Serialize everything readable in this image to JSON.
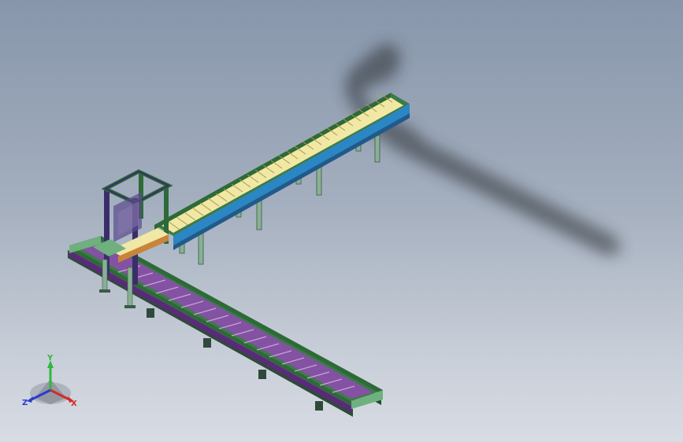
{
  "viewport": {
    "background_top": "#8796ab",
    "background_bottom": "#d8dce3"
  },
  "model": {
    "name": "",
    "parts": [
      "roller-conveyor-upper",
      "roller-conveyor-lower",
      "lift-transfer-frame",
      "support-legs",
      "drop-shadow"
    ],
    "colors": {
      "frame_green": "#2d6a37",
      "side_rail_blue": "#2a86c4",
      "rollers_yellow": "#f0e8a4",
      "rollers_purple": "#7a3c96",
      "legs": "#88b095",
      "lift_frame": "#3a2e6a"
    }
  },
  "triad": {
    "x_label": "X",
    "y_label": "Y",
    "z_label": "Z",
    "x_color": "#d42a2a",
    "y_color": "#2fb83c",
    "z_color": "#2a3ad4"
  }
}
